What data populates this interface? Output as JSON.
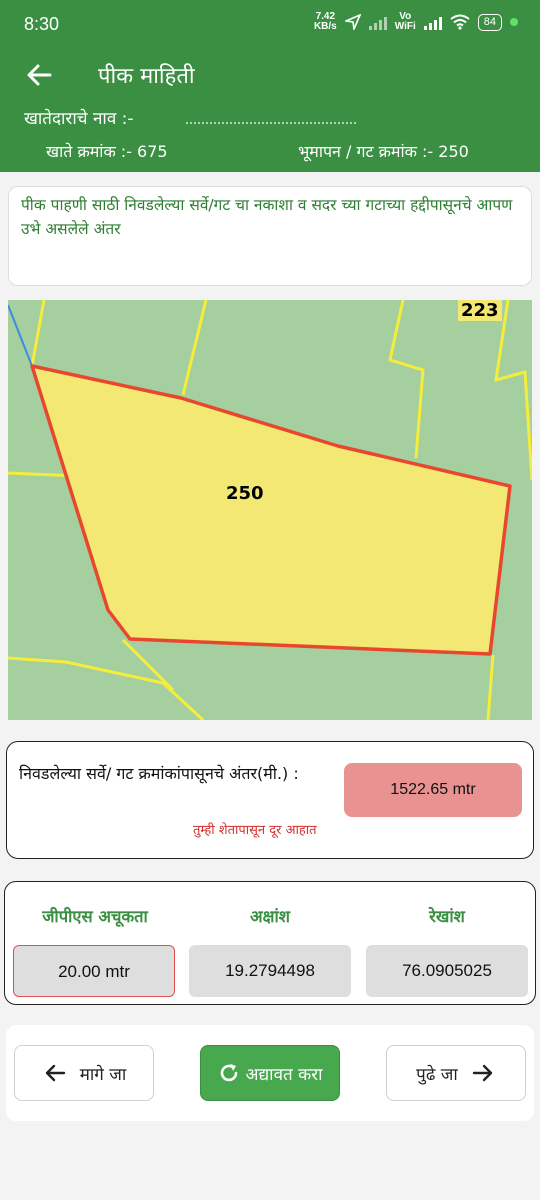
{
  "status_bar": {
    "time": "8:30",
    "speed_value": "7.42",
    "speed_unit": "KB/s",
    "vo": "Vo",
    "wifi_label": "WiFi",
    "battery": "84"
  },
  "app_bar": {
    "title": "पीक माहिती",
    "owner_label": "खातेदाराचे नाव :-",
    "account_label": "खाते क्रमांक :-  675",
    "survey_label": "भूमापन / गट क्रमांक :-  250"
  },
  "info": {
    "text": "पीक पाहणी साठी निवडलेल्या सर्वे/गट चा नकाशा व सदर च्या गटाच्या हद्दीपासूनचे आपण उभे असलेले अंतर"
  },
  "map": {
    "plot_label": "250",
    "neighbor_label": "223",
    "colors": {
      "background": "#a6cfa0",
      "plot_fill": "#f4e874",
      "plot_border": "#e8472e",
      "boundary": "#f4ee3a"
    }
  },
  "distance": {
    "label": "निवडलेल्या सर्वे/ गट क्रमांकांपासूनचे अंतर(मी.) :",
    "value": "1522.65 mtr",
    "warning": "तुम्ही शेतापासून दूर आहात"
  },
  "gps": {
    "accuracy_label": "जीपीएस अचूकता",
    "latitude_label": "अक्षांश",
    "longitude_label": "रेखांश",
    "accuracy_value": "20.00 mtr",
    "latitude_value": "19.2794498",
    "longitude_value": "76.0905025"
  },
  "nav": {
    "back_label": "मागे जा",
    "refresh_label": "अद्यावत करा",
    "next_label": "पुढे जा"
  },
  "colors": {
    "primary": "#3b8f42",
    "warning": "#d03030",
    "distance_bg": "#e89292"
  }
}
